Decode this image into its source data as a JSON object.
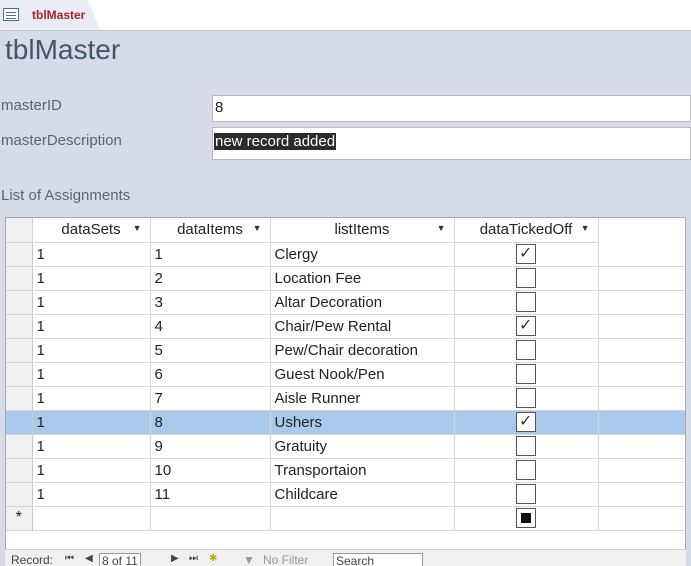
{
  "tab": {
    "label": "tblMaster"
  },
  "form": {
    "title": "tblMaster",
    "masterID_label": "masterID",
    "masterID_value": "8",
    "masterDescription_label": "masterDescription",
    "masterDescription_value": "new record added",
    "list_label": "List of Assignments"
  },
  "grid": {
    "columns": [
      "dataSets",
      "dataItems",
      "listItems",
      "dataTickedOff"
    ],
    "rows": [
      {
        "dataSets": "1",
        "dataItems": "1",
        "listItems": "Clergy",
        "ticked": true
      },
      {
        "dataSets": "1",
        "dataItems": "2",
        "listItems": "Location Fee",
        "ticked": false
      },
      {
        "dataSets": "1",
        "dataItems": "3",
        "listItems": "Altar Decoration",
        "ticked": false
      },
      {
        "dataSets": "1",
        "dataItems": "4",
        "listItems": "Chair/Pew Rental",
        "ticked": true
      },
      {
        "dataSets": "1",
        "dataItems": "5",
        "listItems": "Pew/Chair decoration",
        "ticked": false
      },
      {
        "dataSets": "1",
        "dataItems": "6",
        "listItems": "Guest Nook/Pen",
        "ticked": false
      },
      {
        "dataSets": "1",
        "dataItems": "7",
        "listItems": "Aisle Runner",
        "ticked": false
      },
      {
        "dataSets": "1",
        "dataItems": "8",
        "listItems": "Ushers",
        "ticked": true
      },
      {
        "dataSets": "1",
        "dataItems": "9",
        "listItems": "Gratuity",
        "ticked": false
      },
      {
        "dataSets": "1",
        "dataItems": "10",
        "listItems": "Transportaion",
        "ticked": false
      },
      {
        "dataSets": "1",
        "dataItems": "11",
        "listItems": "Childcare",
        "ticked": false
      }
    ],
    "selected_row": 7,
    "new_row_marker": "*"
  },
  "navigation": {
    "record_label": "Record:",
    "record_position": "8 of 11",
    "filter_label": "No Filter",
    "search_label": "Search"
  },
  "colors": {
    "accent": "#a4262c",
    "selection": "#a8c9e9",
    "background": "#d6dbe9"
  }
}
